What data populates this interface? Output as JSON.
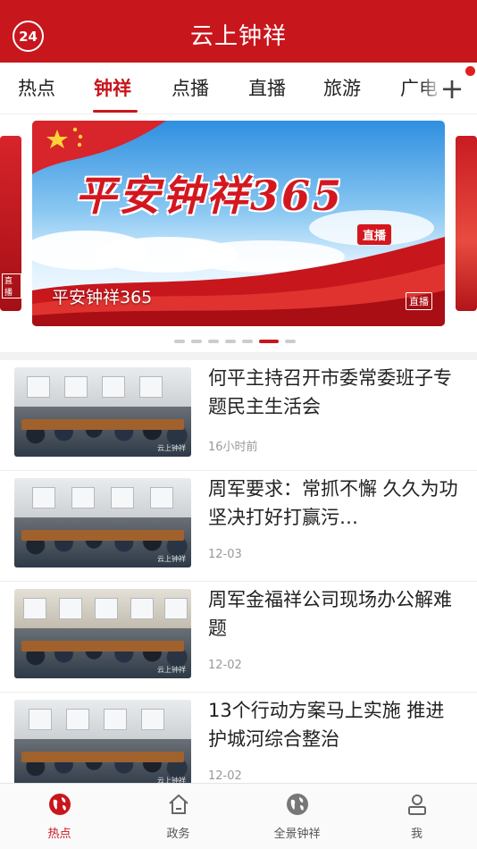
{
  "header": {
    "badge": "24",
    "title": "云上钟祥"
  },
  "tabs": [
    {
      "label": "热点"
    },
    {
      "label": "钟祥"
    },
    {
      "label": "点播"
    },
    {
      "label": "直播"
    },
    {
      "label": "旅游"
    },
    {
      "label": "广电"
    }
  ],
  "carousel": {
    "banner_title": "平安钟祥365",
    "banner_tag": "直播",
    "caption": "平安钟祥365",
    "live_badge": "直播",
    "side_badge": "直播",
    "active_index": 5,
    "count": 7
  },
  "news": [
    {
      "title": "何平主持召开市委常委班子专题民主生活会",
      "time": "16小时前"
    },
    {
      "title": "周军要求：常抓不懈 久久为功 坚决打好打赢污…",
      "time": "12-03"
    },
    {
      "title": "周军金福祥公司现场办公解难题",
      "time": "12-02"
    },
    {
      "title": "13个行动方案马上实施 推进护城河综合整治",
      "time": "12-02"
    }
  ],
  "thumb_watermark": "云上钟祥",
  "bottom_nav": [
    {
      "label": "热点",
      "icon": "globe-icon"
    },
    {
      "label": "政务",
      "icon": "home-icon"
    },
    {
      "label": "全景钟祥",
      "icon": "globe-icon"
    },
    {
      "label": "我",
      "icon": "person-icon"
    }
  ],
  "colors": {
    "brand": "#c8161d"
  }
}
